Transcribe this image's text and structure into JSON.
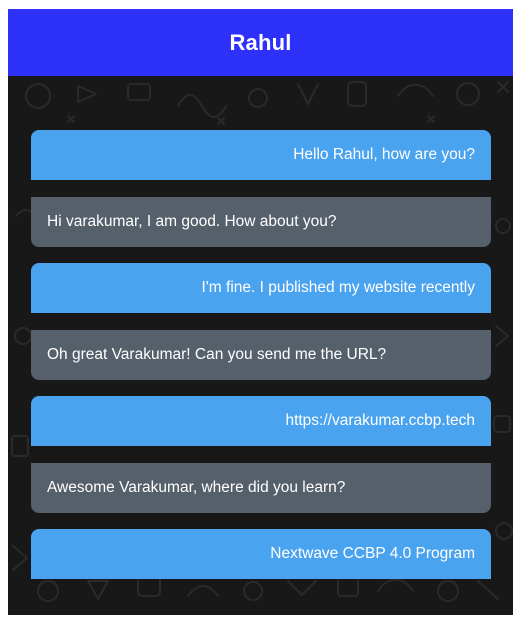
{
  "header": {
    "title": "Rahul",
    "background_color": "#2d31fa"
  },
  "colors": {
    "sent_bubble": "#4aa3ef",
    "received_bubble": "#56606b",
    "chat_background": "#181818"
  },
  "messages": [
    {
      "direction": "sent",
      "text": "Hello Rahul, how are you?"
    },
    {
      "direction": "received",
      "text": "Hi varakumar, I am good. How about you?"
    },
    {
      "direction": "sent",
      "text": "I'm fine. I published my website recently"
    },
    {
      "direction": "received",
      "text": "Oh great Varakumar! Can you send me the URL?"
    },
    {
      "direction": "sent",
      "text": "https://varakumar.ccbp.tech"
    },
    {
      "direction": "received",
      "text": "Awesome Varakumar, where did you learn?"
    },
    {
      "direction": "sent",
      "text": "Nextwave CCBP 4.0 Program"
    }
  ]
}
